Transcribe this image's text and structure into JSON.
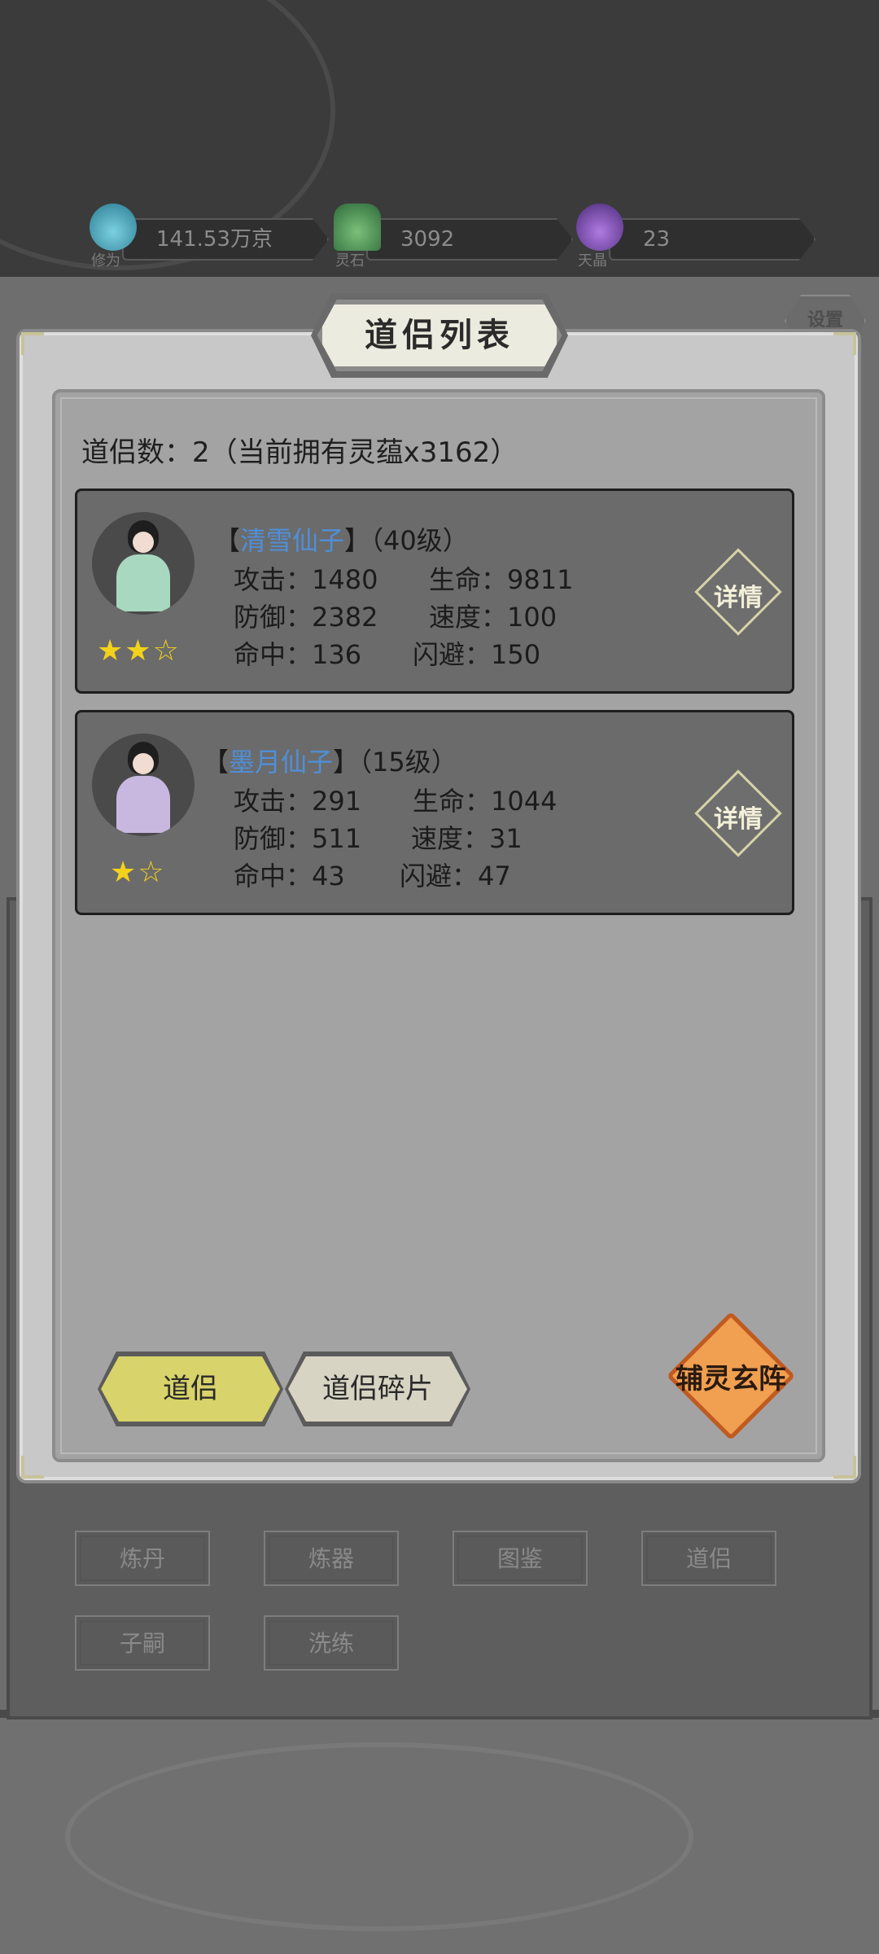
{
  "resources": [
    {
      "label": "修为",
      "value": "141.53万京",
      "color": "#3aa3b8",
      "icon": "cultivation-flame-icon"
    },
    {
      "label": "灵石",
      "value": "3092",
      "color": "#4a9a5a",
      "icon": "spirit-stone-icon"
    },
    {
      "label": "天晶",
      "value": "23",
      "color": "#7a4ab0",
      "icon": "sky-crystal-icon"
    }
  ],
  "settings_label": "设置",
  "modal": {
    "title": "道侣列表",
    "count_text": "道侣数：2（当前拥有灵蕴x3162）",
    "companions": [
      {
        "name": "清雪仙子",
        "bracket_open": "【",
        "bracket_close": "】",
        "level": "（40级）",
        "stats": {
          "attack": "攻击：1480",
          "hp": "生命：9811",
          "defense": "防御：2382",
          "speed": "速度：100",
          "hit": "命中：136",
          "dodge": "闪避：150"
        },
        "stars": "★★☆",
        "robe_color": "#a8d8c0",
        "detail_label": "详情"
      },
      {
        "name": "墨月仙子",
        "bracket_open": "【",
        "bracket_close": "】",
        "level": "（15级）",
        "stats": {
          "attack": "攻击：291",
          "hp": "生命：1044",
          "defense": "防御：511",
          "speed": "速度：31",
          "hit": "命中：43",
          "dodge": "闪避：47"
        },
        "stars": "★☆",
        "robe_color": "#c8b8e0",
        "detail_label": "详情"
      }
    ],
    "tabs": {
      "companion": "道侣",
      "fragments": "道侣碎片"
    },
    "formation_label": "辅灵玄阵"
  },
  "menu": [
    "炼丹",
    "炼器",
    "图鉴",
    "道侣",
    "子嗣",
    "洗练"
  ]
}
